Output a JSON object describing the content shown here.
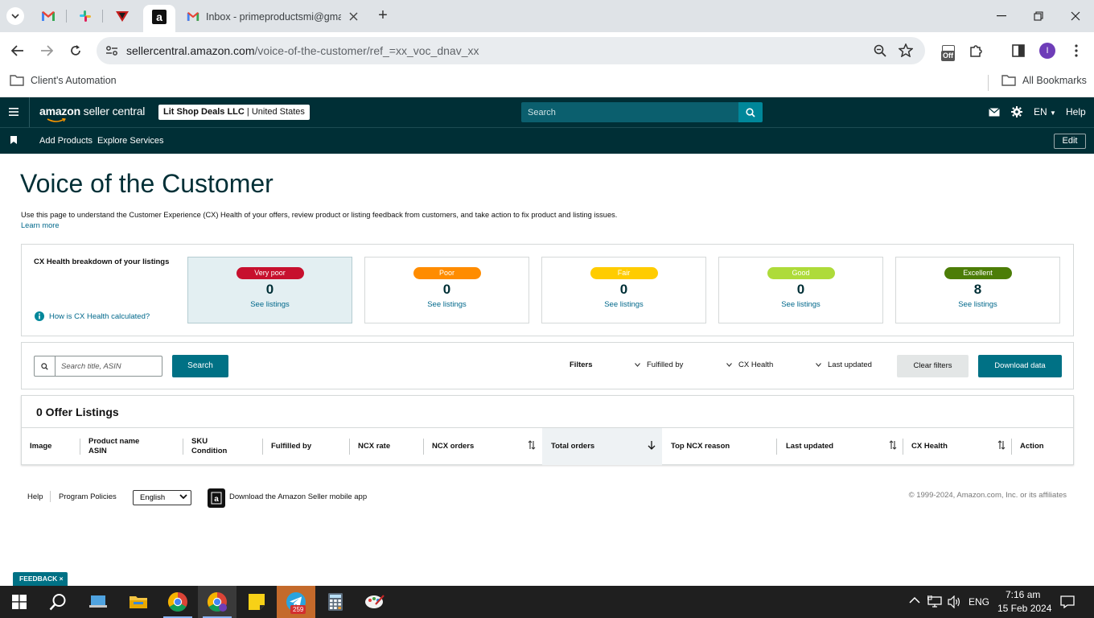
{
  "browser": {
    "tabs": [
      {
        "icon": "gmail-icon"
      },
      {
        "icon": "slack-icon"
      },
      {
        "icon": "triangle-app-icon"
      },
      {
        "icon": "amazon-icon",
        "active": true
      },
      {
        "icon": "gmail-icon",
        "title": "Inbox - primeproductsmi@gma"
      }
    ],
    "new_tab_symbol": "+",
    "url_host": "sellercentral.amazon.com",
    "url_path": "/voice-of-the-customer/ref_=xx_voc_dnav_xx",
    "extension_badge": "Off",
    "profile_initial": "I",
    "bookmarks": {
      "left": "Client's Automation",
      "right": "All Bookmarks"
    }
  },
  "seller_central": {
    "logo_text": "amazon",
    "logo_suffix": "seller central",
    "account_name": "Lit Shop Deals LLC",
    "account_region": "United States",
    "search_placeholder": "Search",
    "language": "EN",
    "help": "Help",
    "nav": {
      "add_products": "Add Products",
      "explore_services": "Explore Services",
      "edit": "Edit"
    }
  },
  "page": {
    "title": "Voice of the Customer",
    "intro": "Use this page to understand the Customer Experience (CX) Health of your offers, review product or listing feedback from customers, and take action to fix product and listing issues.",
    "learn_more": "Learn more"
  },
  "cx_health": {
    "label": "CX Health breakdown of your listings",
    "help_link": "How is CX Health calculated?",
    "see_listings": "See listings",
    "cards": [
      {
        "label": "Very poor",
        "count": "0",
        "color": "#c7102e",
        "text_color": "#ffffff"
      },
      {
        "label": "Poor",
        "count": "0",
        "color": "#ff8c00",
        "text_color": "#ffffff"
      },
      {
        "label": "Fair",
        "count": "0",
        "color": "#ffcc00",
        "text_color": "#ffffff"
      },
      {
        "label": "Good",
        "count": "0",
        "color": "#aedb3a",
        "text_color": "#ffffff"
      },
      {
        "label": "Excellent",
        "count": "8",
        "color": "#4c7d07",
        "text_color": "#ffffff"
      }
    ]
  },
  "filters": {
    "search_placeholder": "Search title, ASIN",
    "search_button": "Search",
    "filters_label": "Filters",
    "fulfilled_by": "Fulfilled by",
    "cx_health": "CX Health",
    "last_updated": "Last updated",
    "clear_filters": "Clear filters",
    "download_data": "Download data"
  },
  "listings": {
    "title": "0 Offer Listings",
    "columns": {
      "image": "Image",
      "product_name": "Product name",
      "asin": "ASIN",
      "sku": "SKU",
      "condition": "Condition",
      "fulfilled_by": "Fulfilled by",
      "ncx_rate": "NCX rate",
      "ncx_orders": "NCX orders",
      "total_orders": "Total orders",
      "top_ncx_reason": "Top NCX reason",
      "last_updated": "Last updated",
      "cx_health": "CX Health",
      "action": "Action"
    }
  },
  "footer": {
    "help": "Help",
    "program_policies": "Program Policies",
    "language": "English",
    "app_download": "Download the Amazon Seller mobile app",
    "copyright": "© 1999-2024, Amazon.com, Inc. or its affiliates"
  },
  "feedback": {
    "label": "FEEDBACK",
    "close": "×"
  },
  "taskbar": {
    "telegram_badge": "259",
    "language": "ENG",
    "time": "7:16 am",
    "date": "15 Feb 2024"
  }
}
